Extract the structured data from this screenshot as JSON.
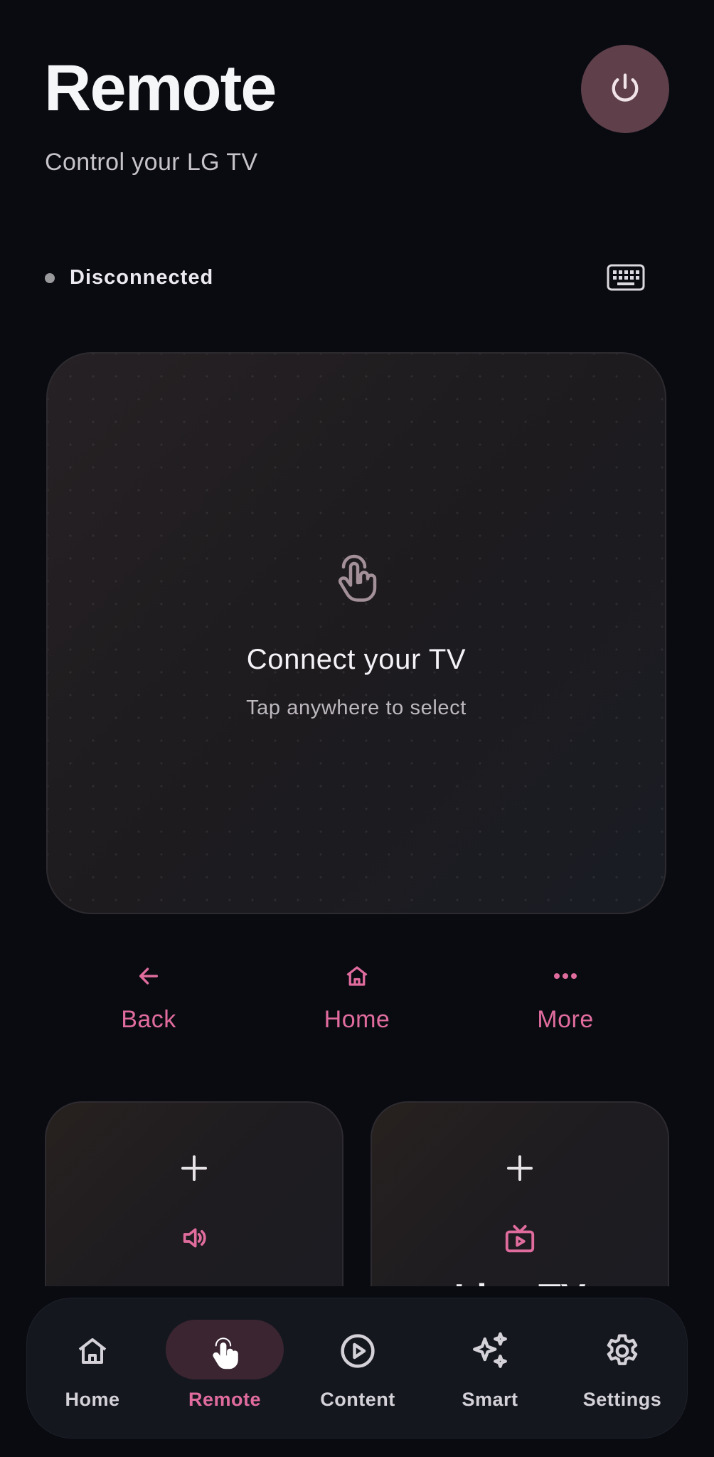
{
  "header": {
    "title": "Remote",
    "subtitle": "Control your LG TV"
  },
  "status": {
    "text": "Disconnected",
    "dot_color": "#9a9a9d"
  },
  "touchpad": {
    "title": "Connect your TV",
    "subtitle": "Tap anywhere to select"
  },
  "nav_buttons": [
    {
      "label": "Back",
      "icon": "arrow-left-icon"
    },
    {
      "label": "Home",
      "icon": "home-icon"
    },
    {
      "label": "More",
      "icon": "more-dots-icon"
    }
  ],
  "cards": [
    {
      "icon": "volume-icon",
      "label": ""
    },
    {
      "icon": "live-tv-icon",
      "label": "Live TV"
    }
  ],
  "bottom_nav": [
    {
      "label": "Home",
      "icon": "home-icon",
      "active": false
    },
    {
      "label": "Remote",
      "icon": "touch-icon",
      "active": true
    },
    {
      "label": "Content",
      "icon": "play-circle-icon",
      "active": false
    },
    {
      "label": "Smart",
      "icon": "sparkles-icon",
      "active": false
    },
    {
      "label": "Settings",
      "icon": "gear-icon",
      "active": false
    }
  ],
  "colors": {
    "accent": "#e06c9e",
    "background": "#090b11",
    "power_button": "#5e3f4a",
    "active_pill": "#3a2531"
  }
}
